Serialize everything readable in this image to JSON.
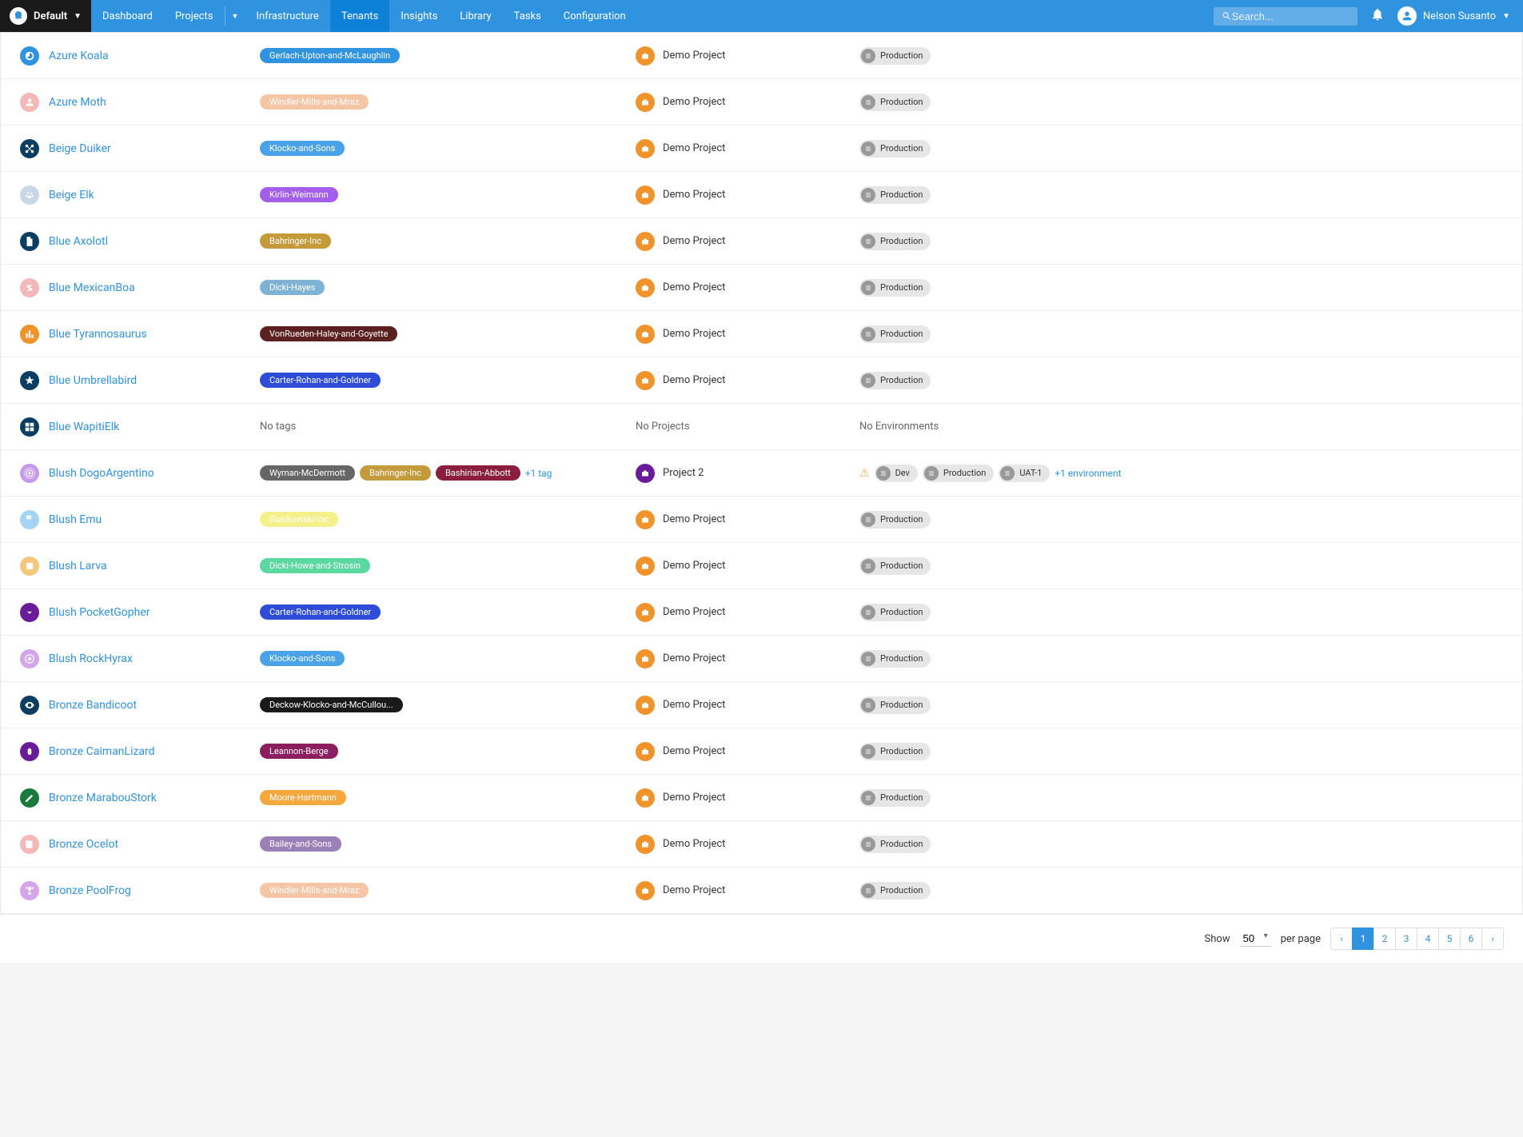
{
  "space": "Default",
  "nav": [
    "Dashboard",
    "Projects",
    "Infrastructure",
    "Tenants",
    "Insights",
    "Library",
    "Tasks",
    "Configuration"
  ],
  "nav_active_index": 3,
  "search_placeholder": "Search...",
  "user_name": "Nelson Susanto",
  "no_tags_text": "No tags",
  "no_projects_text": "No Projects",
  "no_envs_text": "No Environments",
  "demo_project": "Demo Project",
  "tenants": [
    {
      "name": "Azure Koala",
      "icon_bg": "#2f93e0",
      "icon": "swirl",
      "tags": [
        {
          "label": "Gerlach-Upton-and-McLaughlin",
          "bg": "#2f93e0"
        }
      ],
      "project": {
        "name": "Demo Project",
        "bg": "#f0932b"
      },
      "envs": [
        {
          "label": "Production"
        }
      ]
    },
    {
      "name": "Azure Moth",
      "icon_bg": "#f5b8b8",
      "icon": "person",
      "tags": [
        {
          "label": "Windler-Mills-and-Mraz",
          "bg": "#f5c6a5",
          "fg": "#fff"
        }
      ],
      "project": {
        "name": "Demo Project",
        "bg": "#f0932b"
      },
      "envs": [
        {
          "label": "Production"
        }
      ]
    },
    {
      "name": "Beige Duiker",
      "icon_bg": "#0a3d62",
      "icon": "nodes",
      "tags": [
        {
          "label": "Klocko-and-Sons",
          "bg": "#4aa3e8"
        }
      ],
      "project": {
        "name": "Demo Project",
        "bg": "#f0932b"
      },
      "envs": [
        {
          "label": "Production"
        }
      ]
    },
    {
      "name": "Beige Elk",
      "icon_bg": "#c8d6e5",
      "icon": "paw",
      "tags": [
        {
          "label": "Kirlin-Weimann",
          "bg": "#a55eea"
        }
      ],
      "project": {
        "name": "Demo Project",
        "bg": "#f0932b"
      },
      "envs": [
        {
          "label": "Production"
        }
      ]
    },
    {
      "name": "Blue Axolotl",
      "icon_bg": "#0a3d62",
      "icon": "doc",
      "tags": [
        {
          "label": "Bahringer-Inc",
          "bg": "#c49a3a"
        }
      ],
      "project": {
        "name": "Demo Project",
        "bg": "#f0932b"
      },
      "envs": [
        {
          "label": "Production"
        }
      ]
    },
    {
      "name": "Blue MexicanBoa",
      "icon_bg": "#f5b8b8",
      "icon": "dollar",
      "tags": [
        {
          "label": "Dicki-Hayes",
          "bg": "#7fb3d5"
        }
      ],
      "project": {
        "name": "Demo Project",
        "bg": "#f0932b"
      },
      "envs": [
        {
          "label": "Production"
        }
      ]
    },
    {
      "name": "Blue Tyrannosaurus",
      "icon_bg": "#f0932b",
      "icon": "chart",
      "tags": [
        {
          "label": "VonRueden-Haley-and-Goyette",
          "bg": "#5c2020"
        }
      ],
      "project": {
        "name": "Demo Project",
        "bg": "#f0932b"
      },
      "envs": [
        {
          "label": "Production"
        }
      ]
    },
    {
      "name": "Blue Umbrellabird",
      "icon_bg": "#0a3d62",
      "icon": "star",
      "tags": [
        {
          "label": "Carter-Rohan-and-Goldner",
          "bg": "#2e4cd8"
        }
      ],
      "project": {
        "name": "Demo Project",
        "bg": "#f0932b"
      },
      "envs": [
        {
          "label": "Production"
        }
      ]
    },
    {
      "name": "Blue WapitiElk",
      "icon_bg": "#0a3d62",
      "icon": "grid",
      "no_tags": true,
      "no_projects": true,
      "no_envs": true
    },
    {
      "name": "Blush DogoArgentino",
      "icon_bg": "#c49aea",
      "icon": "radio",
      "tags": [
        {
          "label": "Wyman-McDermott",
          "bg": "#666"
        },
        {
          "label": "Bahringer-Inc",
          "bg": "#c49a3a"
        },
        {
          "label": "Bashirian-Abbott",
          "bg": "#8b1e3f"
        }
      ],
      "tags_more": "+1 tag",
      "project": {
        "name": "Project 2",
        "bg": "#6a1b9a"
      },
      "warn": true,
      "envs": [
        {
          "label": "Dev"
        },
        {
          "label": "Production"
        },
        {
          "label": "UAT-1"
        }
      ],
      "envs_more": "+1 environment"
    },
    {
      "name": "Blush Emu",
      "icon_bg": "#a4d4f5",
      "icon": "flag",
      "tags": [
        {
          "label": "Gusikowski-Inc",
          "bg": "#f5f089",
          "fg": "#fff"
        }
      ],
      "project": {
        "name": "Demo Project",
        "bg": "#f0932b"
      },
      "envs": [
        {
          "label": "Production"
        }
      ]
    },
    {
      "name": "Blush Larva",
      "icon_bg": "#f5c77a",
      "icon": "square",
      "tags": [
        {
          "label": "Dicki-Howe-and-Strosin",
          "bg": "#5bd8a0"
        }
      ],
      "project": {
        "name": "Demo Project",
        "bg": "#f0932b"
      },
      "envs": [
        {
          "label": "Production"
        }
      ]
    },
    {
      "name": "Blush PocketGopher",
      "icon_bg": "#6a1b9a",
      "icon": "download",
      "tags": [
        {
          "label": "Carter-Rohan-and-Goldner",
          "bg": "#2e4cd8"
        }
      ],
      "project": {
        "name": "Demo Project",
        "bg": "#f0932b"
      },
      "envs": [
        {
          "label": "Production"
        }
      ]
    },
    {
      "name": "Blush RockHyrax",
      "icon_bg": "#d4a5e8",
      "icon": "target",
      "tags": [
        {
          "label": "Klocko-and-Sons",
          "bg": "#4aa3e8"
        }
      ],
      "project": {
        "name": "Demo Project",
        "bg": "#f0932b"
      },
      "envs": [
        {
          "label": "Production"
        }
      ]
    },
    {
      "name": "Bronze Bandicoot",
      "icon_bg": "#0a3d62",
      "icon": "eye",
      "tags": [
        {
          "label": "Deckow-Klocko-and-McCullou...",
          "bg": "#1a1a1a"
        }
      ],
      "project": {
        "name": "Demo Project",
        "bg": "#f0932b"
      },
      "envs": [
        {
          "label": "Production"
        }
      ]
    },
    {
      "name": "Bronze CaimanLizard",
      "icon_bg": "#6a1b9a",
      "icon": "bug",
      "tags": [
        {
          "label": "Leannon-Berge",
          "bg": "#8b1e5f"
        }
      ],
      "project": {
        "name": "Demo Project",
        "bg": "#f0932b"
      },
      "envs": [
        {
          "label": "Production"
        }
      ]
    },
    {
      "name": "Bronze MarabouStork",
      "icon_bg": "#1a7a3d",
      "icon": "pen",
      "tags": [
        {
          "label": "Moore-Hartmann",
          "bg": "#f5a83d"
        }
      ],
      "project": {
        "name": "Demo Project",
        "bg": "#f0932b"
      },
      "envs": [
        {
          "label": "Production"
        }
      ]
    },
    {
      "name": "Bronze Ocelot",
      "icon_bg": "#f5b8b8",
      "icon": "book",
      "tags": [
        {
          "label": "Bailey-and-Sons",
          "bg": "#9b7fb8"
        }
      ],
      "project": {
        "name": "Demo Project",
        "bg": "#f0932b"
      },
      "envs": [
        {
          "label": "Production"
        }
      ]
    },
    {
      "name": "Bronze PoolFrog",
      "icon_bg": "#d4a5e8",
      "icon": "trophy",
      "tags": [
        {
          "label": "Windler-Mills-and-Mraz",
          "bg": "#f5c6a5",
          "fg": "#fff"
        }
      ],
      "project": {
        "name": "Demo Project",
        "bg": "#f0932b"
      },
      "envs": [
        {
          "label": "Production"
        }
      ]
    }
  ],
  "footer": {
    "show_label": "Show",
    "page_size": "50",
    "per_page_label": "per page",
    "pages": [
      "1",
      "2",
      "3",
      "4",
      "5",
      "6"
    ],
    "active_page_index": 0
  }
}
